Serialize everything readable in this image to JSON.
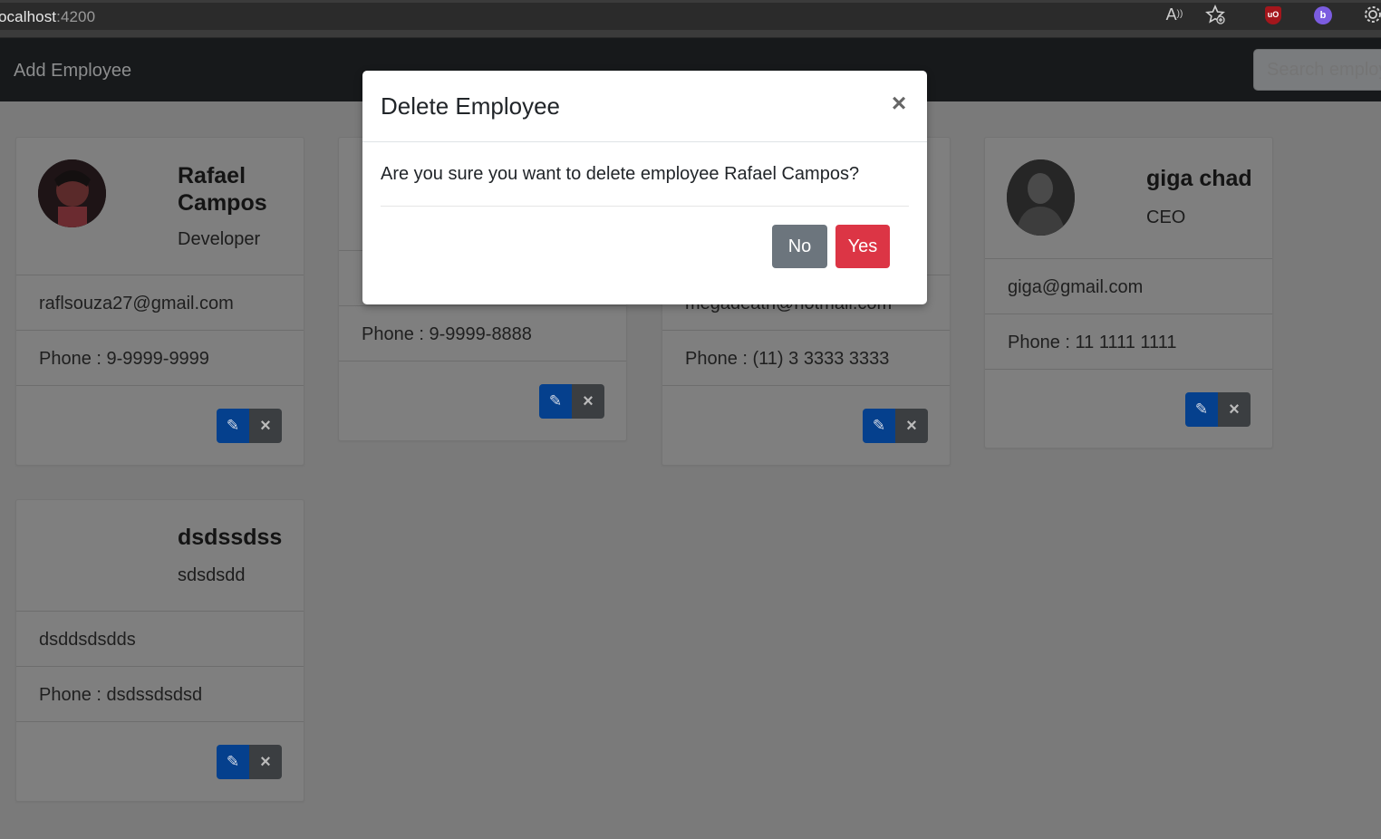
{
  "browser": {
    "url_host": "ocalhost",
    "url_port": ":4200"
  },
  "navbar": {
    "add_label": "Add Employee",
    "search_placeholder": "Search employees..."
  },
  "employees": [
    {
      "name_line1": "Rafael",
      "name_line2": "Campos",
      "title": "Developer",
      "email": "raflsouza27@gmail.com",
      "phone": "Phone : 9-9999-9999"
    },
    {
      "phone": "Phone : 9-9999-8888"
    },
    {
      "email": "megadeath@hotmail.com",
      "phone": "Phone : (11) 3 3333 3333"
    },
    {
      "name": "giga chad",
      "title": "CEO",
      "email": "giga@gmail.com",
      "phone": "Phone : 11 1111 1111"
    },
    {
      "name": "dsdssdss",
      "title": "sdsdsdd",
      "email": "dsddsdsdds",
      "phone": "Phone : dsdssdsdsd"
    }
  ],
  "modal": {
    "title": "Delete Employee",
    "message": "Are you sure you want to delete employee Rafael Campos?",
    "close_label": "×",
    "no_label": "No",
    "yes_label": "Yes"
  },
  "colors": {
    "navbar": "#17191b",
    "overlay": "#7a7a7a",
    "edit_button": "#05408d",
    "delete_button": "#3b3e41",
    "no_button": "#6c757d",
    "yes_button": "#dc3545"
  }
}
